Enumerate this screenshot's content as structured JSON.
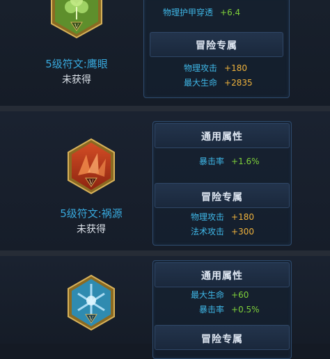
{
  "runes": [
    {
      "icon": "green-rune-icon",
      "name": "5级符文:鹰眼",
      "status": "未获得",
      "general_stats": [
        {
          "name": "物理护甲穿透",
          "value": "+6.4"
        }
      ],
      "adventure_title": "冒险专属",
      "adventure_stats": [
        {
          "name": "物理攻击",
          "value": "+180"
        },
        {
          "name": "最大生命",
          "value": "+2835"
        }
      ]
    },
    {
      "icon": "red-rune-icon",
      "name": "5级符文:祸源",
      "status": "未获得",
      "general_title": "通用属性",
      "general_stats": [
        {
          "name": "暴击率",
          "value": "+1.6%"
        }
      ],
      "adventure_title": "冒险专属",
      "adventure_stats": [
        {
          "name": "物理攻击",
          "value": "+180"
        },
        {
          "name": "法术攻击",
          "value": "+300"
        }
      ]
    },
    {
      "icon": "blue-rune-icon",
      "general_title": "通用属性",
      "general_stats": [
        {
          "name": "最大生命",
          "value": "+60"
        },
        {
          "name": "暴击率",
          "value": "+0.5%"
        }
      ],
      "adventure_title": "冒险专属"
    }
  ],
  "colors": {
    "rune_name": "#38a9dd",
    "stat_name": "#3fb8e8",
    "stat_value_orange": "#f0b33c",
    "stat_value_green": "#7fd13a",
    "title": "#dfe7f2"
  },
  "rune_level_mark": "V"
}
